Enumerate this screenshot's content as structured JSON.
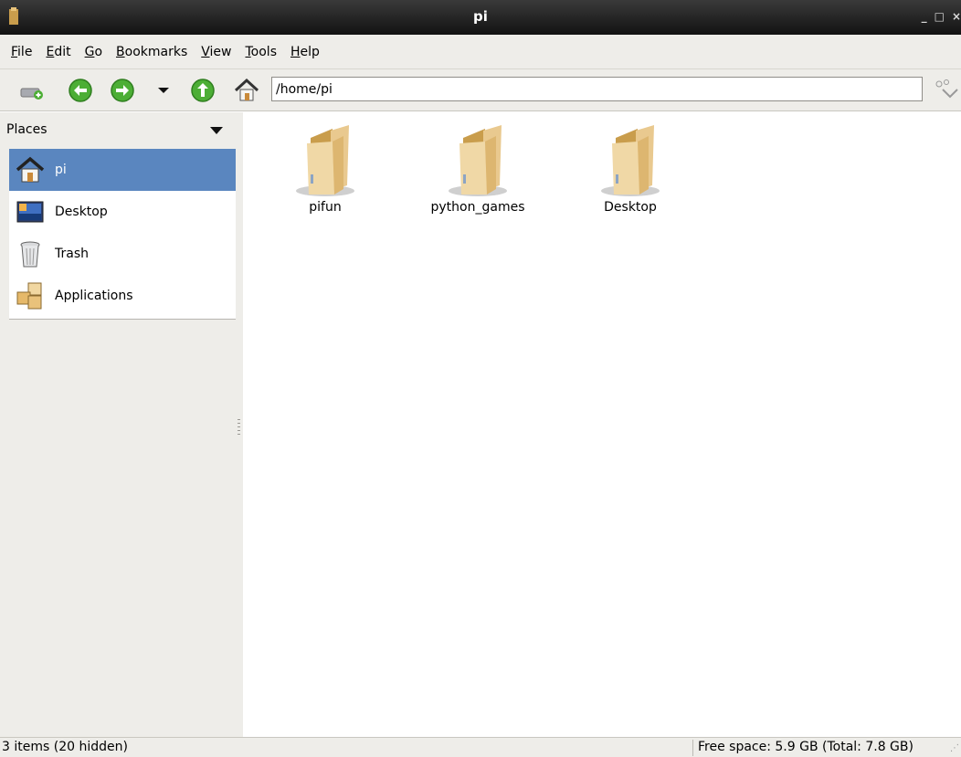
{
  "window": {
    "title": "pi",
    "buttons": [
      "_",
      "□",
      "×"
    ]
  },
  "menubar": [
    {
      "accel": "F",
      "rest": "ile"
    },
    {
      "accel": "E",
      "rest": "dit"
    },
    {
      "accel": "G",
      "rest": "o"
    },
    {
      "accel": "B",
      "rest": "ookmarks"
    },
    {
      "accel": "V",
      "rest": "iew"
    },
    {
      "accel": "T",
      "rest": "ools"
    },
    {
      "accel": "H",
      "rest": "elp"
    }
  ],
  "toolbar": {
    "address": "/home/pi",
    "icons": [
      "new-tab-icon",
      "back-icon",
      "forward-icon",
      "history-dropdown-icon",
      "up-icon",
      "home-icon",
      "go-icon"
    ]
  },
  "sidepane": {
    "header": "Places",
    "places": [
      {
        "label": "pi",
        "icon": "home-icon",
        "selected": true
      },
      {
        "label": "Desktop",
        "icon": "desktop-icon",
        "selected": false
      },
      {
        "label": "Trash",
        "icon": "trash-icon",
        "selected": false
      },
      {
        "label": "Applications",
        "icon": "applications-icon",
        "selected": false
      }
    ]
  },
  "files": [
    {
      "name": "pifun",
      "icon": "folder-icon"
    },
    {
      "name": "python_games",
      "icon": "folder-icon"
    },
    {
      "name": "Desktop",
      "icon": "folder-icon"
    }
  ],
  "statusbar": {
    "items": "3 items (20 hidden)",
    "space": "Free space: 5.9 GB (Total: 7.8 GB)"
  },
  "colors": {
    "selection": "#5a86bf",
    "chrome": "#eeede9",
    "folder": "#e9c98f",
    "nav_green": "#4cae35"
  }
}
